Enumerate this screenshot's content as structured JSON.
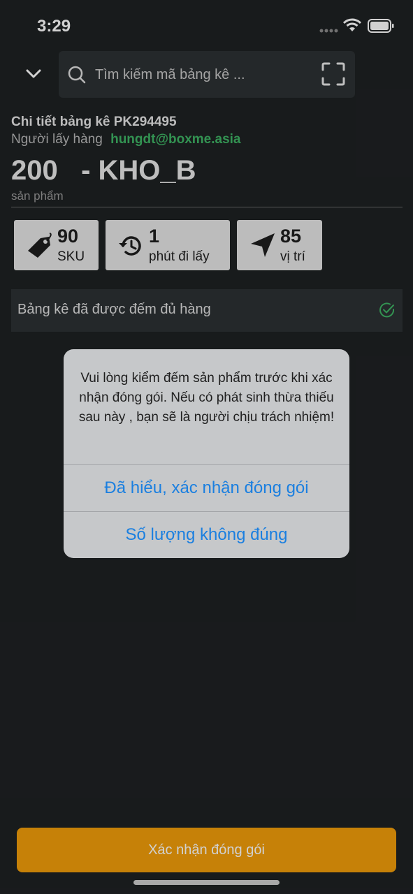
{
  "status_bar": {
    "time": "3:29"
  },
  "search": {
    "placeholder": "Tìm kiếm mã bảng kê ..."
  },
  "detail": {
    "title": "Chi tiết bảng kê PK294495",
    "picker_label": "Người lấy hàng",
    "picker_email": "hungdt@boxme.asia",
    "quantity_line": "200   - KHO_B",
    "quantity_unit": "sản phẩm"
  },
  "stats": [
    {
      "value": "90",
      "label": "SKU",
      "icon": "tag-icon"
    },
    {
      "value": "1",
      "label": "phút đi lấy",
      "icon": "history-icon"
    },
    {
      "value": "85",
      "label": "vị trí",
      "icon": "location-arrow-icon"
    }
  ],
  "banner": {
    "text": "Bảng kê đã được đếm đủ hàng",
    "icon": "check-circle-icon"
  },
  "alert": {
    "message": "Vui lòng kiểm đếm sản phẩm trước khi xác nhận đóng gói. Nếu có phát sinh thừa thiếu sau này , bạn sẽ là người chịu trách nhiệm!",
    "confirm_label": "Đã hiểu, xác nhận đóng gói",
    "wrong_qty_label": "Số lượng không đúng"
  },
  "footer": {
    "confirm_label": "Xác nhận đóng gói"
  },
  "colors": {
    "background": "#1e2123",
    "accent_green": "#3fb465",
    "primary_button": "#f29e0a",
    "alert_action": "#1a7fe0"
  }
}
